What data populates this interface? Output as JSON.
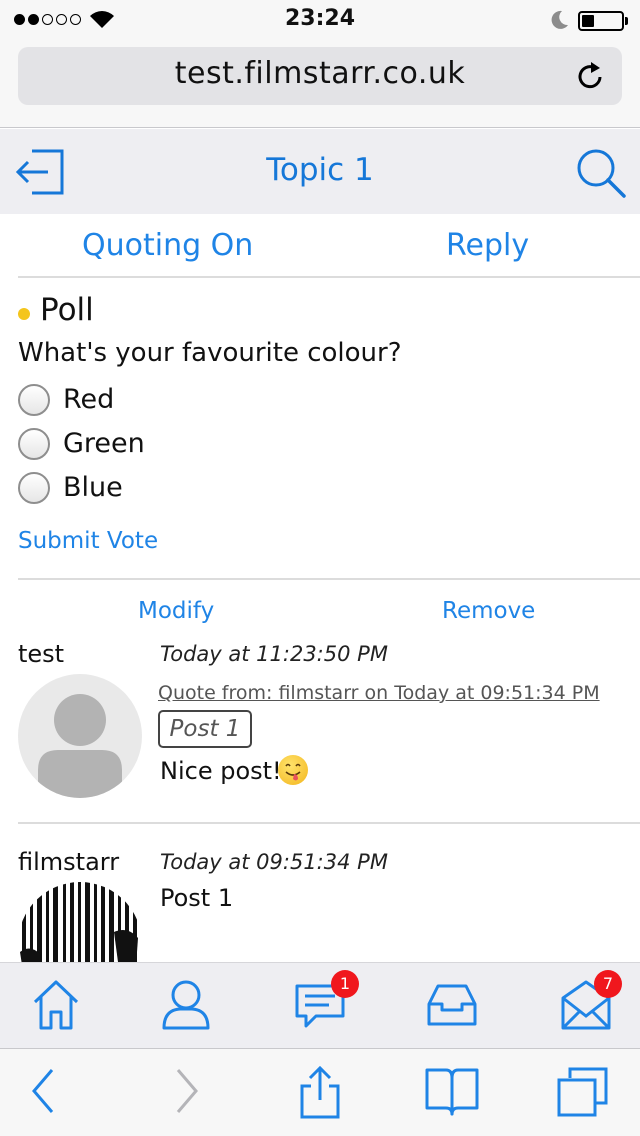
{
  "status": {
    "time": "23:24"
  },
  "browser": {
    "url": "test.filmstarr.co.uk"
  },
  "nav": {
    "title": "Topic 1"
  },
  "actions": {
    "quoting": "Quoting On",
    "reply": "Reply"
  },
  "poll": {
    "title": "Poll",
    "question": "What's your favourite colour?",
    "options": [
      "Red",
      "Green",
      "Blue"
    ],
    "submit": "Submit Vote"
  },
  "post_actions": {
    "modify": "Modify",
    "remove": "Remove"
  },
  "posts": [
    {
      "author": "test",
      "timestamp": "Today at 11:23:50 PM",
      "quote_from": "Quote from: filmstarr on Today at 09:51:34 PM",
      "quote_text": "Post 1",
      "body": "Nice post!"
    },
    {
      "author": "filmstarr",
      "timestamp": "Today at 09:51:34 PM",
      "body": "Post 1"
    }
  ],
  "tabbar": {
    "items": [
      "home-icon",
      "profile-icon",
      "messages-icon",
      "inbox-icon",
      "mail-icon"
    ],
    "messages_badge": "1",
    "mail_badge": "7"
  },
  "colors": {
    "accent": "#1f84e6",
    "badge": "#f0171d",
    "poll_dot": "#f4c51c"
  }
}
